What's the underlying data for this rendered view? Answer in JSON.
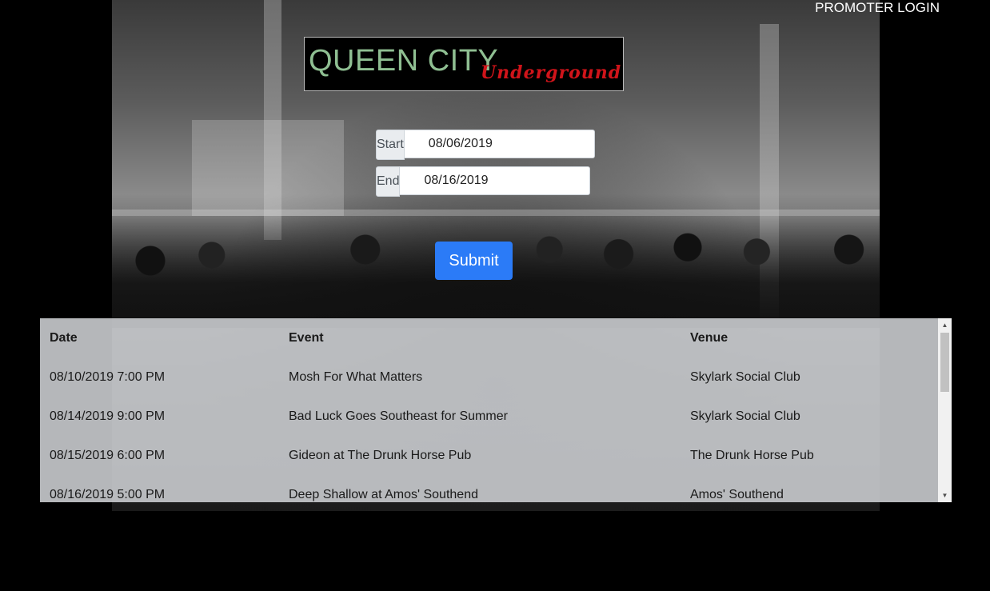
{
  "header": {
    "promoter_login": "PROMOTER LOGIN"
  },
  "logo": {
    "main_text": "QUEEN CITY",
    "sub_text": "Underground"
  },
  "form": {
    "start_label": "Start",
    "start_value": "08/06/2019",
    "end_label": "End",
    "end_value": "08/16/2019",
    "submit_label": "Submit"
  },
  "events_table": {
    "headers": [
      "Date",
      "Event",
      "Venue"
    ],
    "rows": [
      [
        "08/10/2019 7:00 PM",
        "Mosh For What Matters",
        "Skylark Social Club"
      ],
      [
        "08/14/2019 9:00 PM",
        "Bad Luck Goes Southeast for Summer",
        "Skylark Social Club"
      ],
      [
        "08/15/2019 6:00 PM",
        "Gideon at The Drunk Horse Pub",
        "The Drunk Horse Pub"
      ],
      [
        "08/16/2019 5:00 PM",
        "Deep Shallow at Amos' Southend",
        "Amos' Southend"
      ]
    ]
  },
  "colors": {
    "submit_bg": "#2b7bf7",
    "logo_main": "#8fbf92",
    "logo_sub": "#d0141a"
  },
  "icons": {
    "scroll_up": "triangle-up-icon",
    "scroll_down": "triangle-down-icon"
  }
}
